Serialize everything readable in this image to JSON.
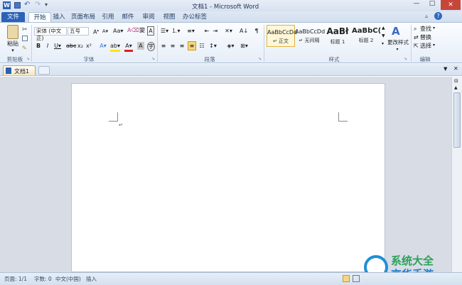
{
  "window": {
    "title": "文档1 - Microsoft Word"
  },
  "tabs": [
    {
      "label": "文件"
    },
    {
      "label": "开始"
    },
    {
      "label": "插入"
    },
    {
      "label": "页面布局"
    },
    {
      "label": "引用"
    },
    {
      "label": "邮件"
    },
    {
      "label": "审阅"
    },
    {
      "label": "视图"
    },
    {
      "label": "办公标签"
    }
  ],
  "clipboard": {
    "paste_label": "粘贴",
    "group_label": "剪贴板"
  },
  "font": {
    "family": "宋体 (中文正)",
    "size": "五号",
    "group_label": "字体"
  },
  "paragraph": {
    "group_label": "段落"
  },
  "styles": {
    "group_label": "样式",
    "items": [
      {
        "preview": "AaBbCcDd",
        "name": "↵ 正文"
      },
      {
        "preview": "AaBbCcDd",
        "name": "↵ 无间隔"
      },
      {
        "preview": "AaBł",
        "name": "标题 1"
      },
      {
        "preview": "AaBbC(",
        "name": "标题 2"
      }
    ],
    "change_label": "更改样式"
  },
  "editing": {
    "group_label": "编辑",
    "find": "查找",
    "replace": "替换",
    "select": "选择"
  },
  "doc_tab": {
    "label": "文档1"
  },
  "status": {
    "page": "页面: 1/1",
    "words": "字数: 0",
    "language": "中文(中国)",
    "mode": "插入"
  },
  "watermark": {
    "line1": "系统大全",
    "line2": "京华手游"
  },
  "colors": {
    "file_tab": "#2a62b8",
    "ribbon_border": "#a9bdd6",
    "doc_bg": "#d8dde5"
  }
}
